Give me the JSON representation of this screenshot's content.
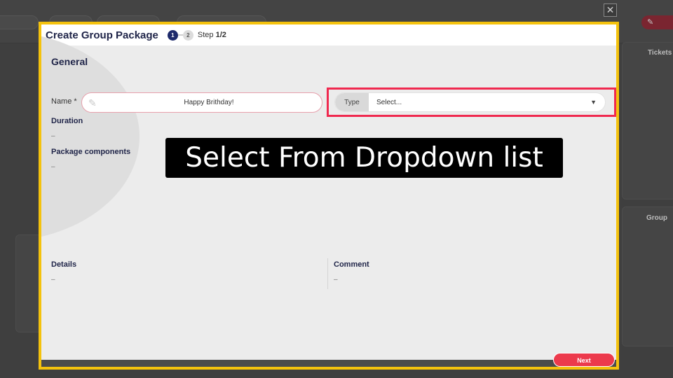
{
  "background": {
    "right_labels": [
      "Tickets",
      "Group"
    ],
    "red_button_icon": "wrench-icon"
  },
  "modal": {
    "title": "Create Group Package",
    "steps": [
      {
        "number": "1",
        "active": true
      },
      {
        "number": "2",
        "active": false
      }
    ],
    "step_text": "Step ",
    "step_value": "1/2",
    "section_title": "General",
    "name": {
      "label": "Name *",
      "value": "Happy Brithday!"
    },
    "type": {
      "tag": "Type",
      "value": "Select..."
    },
    "duration": {
      "label": "Duration",
      "value": "–"
    },
    "package_components": {
      "label": "Package components",
      "value": "–"
    },
    "details": {
      "label": "Details",
      "value": "–"
    },
    "comment": {
      "label": "Comment",
      "value": "–"
    },
    "next_label": "Next"
  },
  "instruction": "Select From Dropdown list",
  "colors": {
    "accent_yellow": "#f4c20d",
    "highlight_red": "#f0294f",
    "next_button": "#ec3a4c",
    "title_navy": "#1f2448",
    "step_active": "#1e2a6b"
  }
}
